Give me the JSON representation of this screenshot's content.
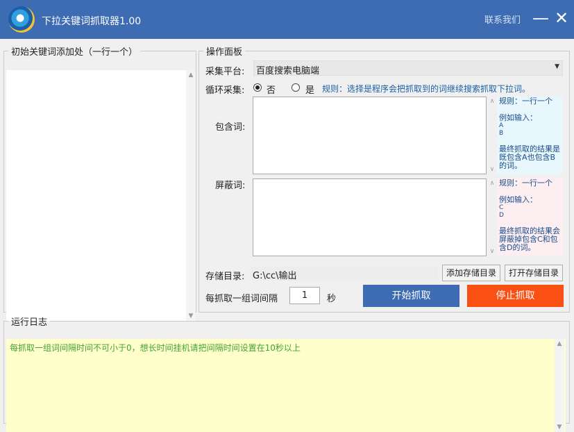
{
  "window": {
    "title": "下拉关键词抓取器1.00",
    "contact_link": "联系我们",
    "minimize_glyph": "—",
    "close_glyph": "✕",
    "title_bar_color": "#3d6cb3"
  },
  "keywords_panel": {
    "legend": "初始关键词添加处（一行一个）",
    "value": ""
  },
  "ops_panel": {
    "legend": "操作面板",
    "platform": {
      "label": "采集平台:",
      "selected": "百度搜索电脑端"
    },
    "loop": {
      "label": "循环采集:",
      "option_no": "否",
      "option_yes": "是",
      "selected": "否",
      "rule_note": "规则：选择是程序会把抓取到的词继续搜索抓取下拉词。"
    },
    "include": {
      "label": "包含词:",
      "value": "",
      "hint": {
        "rule": "规则：一行一个",
        "example_label": "例如输入：",
        "example_lines": [
          "A",
          "B"
        ],
        "result": "最终抓取的结果是既包含A也包含B的词。"
      }
    },
    "exclude": {
      "label": "屏蔽词:",
      "value": "",
      "hint": {
        "rule": "规则：一行一个",
        "example_label": "例如输入：",
        "example_lines": [
          "C",
          "D"
        ],
        "result": "最终抓取的结果会屏蔽掉包含C和包含D的词。"
      }
    },
    "storage": {
      "label": "存储目录:",
      "path": "G:\\cc\\输出",
      "add_button": "添加存储目录",
      "open_button": "打开存储目录"
    },
    "interval": {
      "label": "每抓取一组词间隔",
      "value": "1",
      "unit": "秒"
    },
    "start_button": "开始抓取",
    "stop_button": "停止抓取",
    "start_color": "#3d6cb3",
    "stop_color": "#fa5014"
  },
  "log_panel": {
    "legend": "运行日志",
    "lines": [
      "每抓取一组词间隔时间不可小于0，想长时间挂机请把间隔时间设置在10秒以上"
    ]
  }
}
